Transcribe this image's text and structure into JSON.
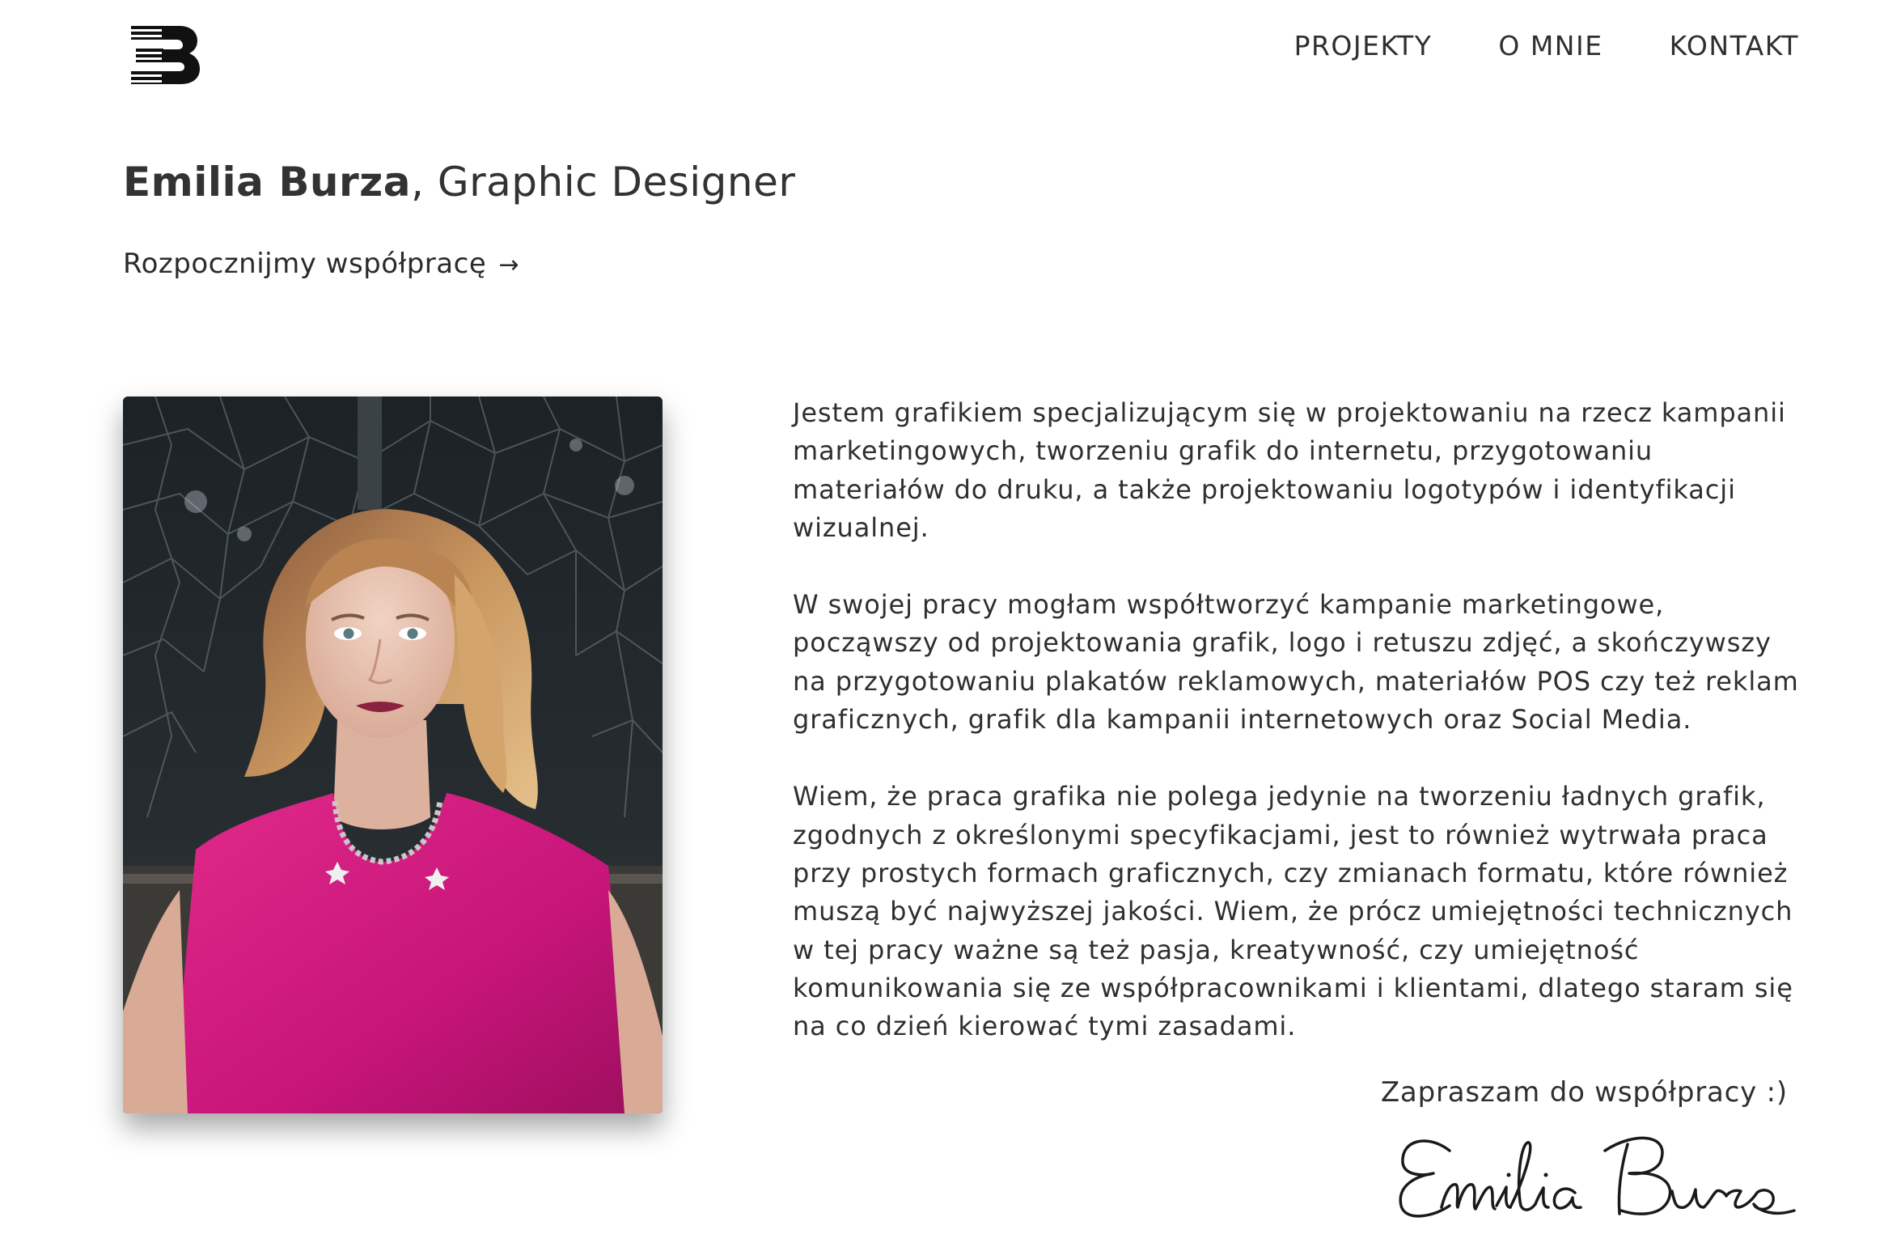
{
  "nav": {
    "logo_alt": "EB",
    "items": [
      "PROJEKTY",
      "O MNIE",
      "KONTAKT"
    ]
  },
  "hero": {
    "name": "Emilia Burza",
    "role": ", Graphic Designer",
    "cta_label": "Rozpocznijmy współpracę",
    "cta_arrow": "→"
  },
  "bio": {
    "paragraphs": [
      "Jestem grafikiem specjalizującym się w projektowaniu na rzecz kampanii marketingowych, tworzeniu grafik do internetu, przygotowaniu materiałów do druku, a także projektowaniu logotypów i identyfikacji wizualnej.",
      "W swojej pracy mogłam współtworzyć kampanie marketingowe, począwszy od projektowania grafik, logo i retuszu zdjęć, a skończywszy na przygotowaniu plakatów reklamowych, materiałów POS czy też reklam graficznych, grafik dla kampanii internetowych oraz Social Media.",
      "Wiem, że praca grafika nie polega jedynie na tworzeniu ładnych grafik, zgodnych z określonymi specyfikacjami, jest to również wytrwała praca przy prostych formach graficznych, czy zmianach formatu, które również muszą być najwyższej jakości. Wiem, że prócz umiejętności technicznych w tej pracy ważne są też pasja, kreatywność, czy umiejętność komunikowania się ze współpracownikami i klientami, dlatego staram się na co dzień kierować tymi zasadami."
    ],
    "invite": "Zapraszam do współpracy :)",
    "signature_text": "Emilia Burza"
  },
  "colors": {
    "text": "#333333",
    "dress": "#d0197a",
    "background": "#ffffff"
  }
}
